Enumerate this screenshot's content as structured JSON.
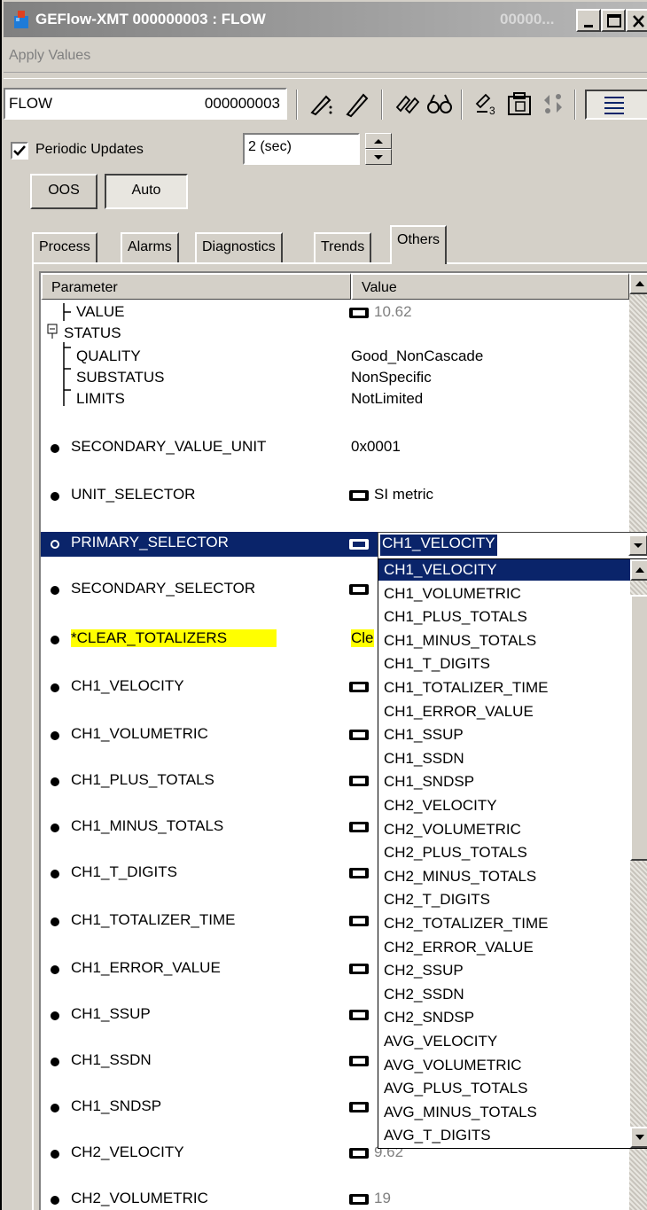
{
  "window": {
    "title": "GEFlow-XMT  000000003 : FLOW",
    "title_faded": "00000..."
  },
  "menu": {
    "apply_values": "Apply Values"
  },
  "toolbar": {
    "tag": "FLOW",
    "device_id": "000000003"
  },
  "periodic": {
    "label": "Periodic Updates",
    "checked": true,
    "interval": "2 (sec)"
  },
  "mode": {
    "oos": "OOS",
    "auto": "Auto"
  },
  "tabs": [
    "Process",
    "Alarms",
    "Diagnostics",
    "Trends",
    "Others"
  ],
  "grid": {
    "col_parameter": "Parameter",
    "col_value": "Value",
    "tree": [
      {
        "name": "VALUE",
        "value": "10.62"
      },
      {
        "name": "STATUS",
        "value": ""
      },
      {
        "name": "QUALITY",
        "value": "Good_NonCascade"
      },
      {
        "name": "SUBSTATUS",
        "value": "NonSpecific"
      },
      {
        "name": "LIMITS",
        "value": "NotLimited"
      }
    ],
    "rows": [
      {
        "name": "SECONDARY_VALUE_UNIT",
        "value": "0x0001"
      },
      {
        "name": "UNIT_SELECTOR",
        "value": "SI metric"
      },
      {
        "name": "PRIMARY_SELECTOR",
        "value": "CH1_VELOCITY"
      },
      {
        "name": "SECONDARY_SELECTOR",
        "value": ""
      },
      {
        "name": "CLEAR_TOTALIZERS",
        "marker": "*",
        "value": "Cle"
      },
      {
        "name": "CH1_VELOCITY",
        "value": ""
      },
      {
        "name": "CH1_VOLUMETRIC",
        "value": ""
      },
      {
        "name": "CH1_PLUS_TOTALS",
        "value": ""
      },
      {
        "name": "CH1_MINUS_TOTALS",
        "value": ""
      },
      {
        "name": "CH1_T_DIGITS",
        "value": ""
      },
      {
        "name": "CH1_TOTALIZER_TIME",
        "value": ""
      },
      {
        "name": "CH1_ERROR_VALUE",
        "value": ""
      },
      {
        "name": "CH1_SSUP",
        "value": ""
      },
      {
        "name": "CH1_SSDN",
        "value": ""
      },
      {
        "name": "CH1_SNDSP",
        "value": ""
      },
      {
        "name": "CH2_VELOCITY",
        "value": "9.62"
      },
      {
        "name": "CH2_VOLUMETRIC",
        "value": "19"
      }
    ]
  },
  "dropdown": {
    "selected": "CH1_VELOCITY",
    "options": [
      "CH1_VELOCITY",
      "CH1_VOLUMETRIC",
      "CH1_PLUS_TOTALS",
      "CH1_MINUS_TOTALS",
      "CH1_T_DIGITS",
      "CH1_TOTALIZER_TIME",
      "CH1_ERROR_VALUE",
      "CH1_SSUP",
      "CH1_SSDN",
      "CH1_SNDSP",
      "CH2_VELOCITY",
      "CH2_VOLUMETRIC",
      "CH2_PLUS_TOTALS",
      "CH2_MINUS_TOTALS",
      "CH2_T_DIGITS",
      "CH2_TOTALIZER_TIME",
      "CH2_ERROR_VALUE",
      "CH2_SSUP",
      "CH2_SSDN",
      "CH2_SNDSP",
      "AVG_VELOCITY",
      "AVG_VOLUMETRIC",
      "AVG_PLUS_TOTALS",
      "AVG_MINUS_TOTALS",
      "AVG_T_DIGITS"
    ]
  },
  "colors": {
    "selection": "#0a246a",
    "highlight": "#ffff00",
    "face": "#d4d0c8"
  }
}
